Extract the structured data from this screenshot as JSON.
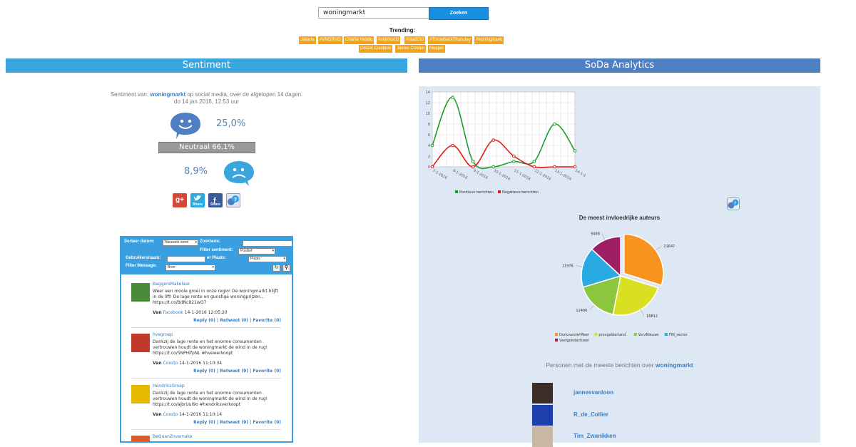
{
  "search": {
    "value": "woningmarkt",
    "button": "Zoeken"
  },
  "trending": {
    "title": "Trending:",
    "tags": [
      "Jakarta",
      "#VNGRNG",
      "Charlie Hebdo",
      "#mijnhoofd",
      "#raad010",
      "#ThrowbackThursday",
      "#woningmarkt",
      "Omzet Coolblue",
      "James Corden",
      "Meppel"
    ]
  },
  "sentiment": {
    "header": "Sentiment",
    "line1_prefix": "Sentiment van:",
    "keyword": "woningmarkt",
    "line1_suffix": "op social media, over de afgelopen 14 dagen.",
    "line2": "do 14 jan 2016, 12:53 uur",
    "positive": "25,0%",
    "neutral": "Neutraal 66,1%",
    "negative": "8,9%",
    "share": {
      "gplus": "g+",
      "twitter": "Share",
      "facebook": "Share"
    }
  },
  "messages": {
    "filters": {
      "sort_label": "Sorteer datum:",
      "sort_value": "Nieuwste eerst",
      "search_label": "Zoekterm:",
      "sentiment_label": "Filter sentiment:",
      "sentiment_value": "Positief",
      "username_label": "Gebruikersnaam:",
      "place_label": "er Plaats:",
      "place_value": "Plaats",
      "message_label": "Filter Message:",
      "source_value": "Bron"
    },
    "items": [
      {
        "user": "BaggersMakelaar",
        "text": "Weer een mooie groei in onze regio! De woningmarkt blijft in de lift! De lage rente en gunstige woningprijzen... https://t.co/BdNc821wO7",
        "van": "Van",
        "source": "Facebook",
        "date": "14-1-2016 12:05:20",
        "actions": "Reply (0) | Retweet (0) | Favorite (0)"
      },
      {
        "user": "hvegroep",
        "text": "Dankzij de lage rente en het enorme consumenten vertrouwen houdt de woningmarkt de wind in de rug! https://t.co/SNPHifpNL #hvewerkoopt",
        "van": "Van",
        "source": "Coosto",
        "date": "14-1-2016 11:10:34",
        "actions": "Reply (0) | Retweet (0) | Favorite (0)"
      },
      {
        "user": "HendriksGroep",
        "text": "Dankzij de lage rente en het enorme consumenten vertrouwen houdt de woningmarkt de wind in de rug! https://t.co/ajbrUuI9o #hendriksverkoopt",
        "van": "Van",
        "source": "Coosto",
        "date": "14-1-2016 11:10:14",
        "actions": "Reply (0) | Retweet (0) | Favorite (0)"
      },
      {
        "user": "BeQuanZnvamake",
        "text": "",
        "van": "",
        "source": "",
        "date": "",
        "actions": ""
      }
    ]
  },
  "analytics": {
    "header": "SoDa Analytics",
    "pie_title": "De meest invloedrijke auteurs",
    "persons_title_prefix": "Personen met de meeste berichten over",
    "persons_keyword": "woningmarkt",
    "persons": [
      "jannesvanloon",
      "R_de_Collier",
      "Tim_Zwanikken"
    ]
  },
  "chart_data": [
    {
      "type": "line",
      "x": [
        "7-1-2016",
        "8-1-2016",
        "9-1-2016",
        "10-1-2016",
        "11-1-2016",
        "12-1-2016",
        "13-1-2016",
        "14-1-2016"
      ],
      "x_values": [
        0,
        1,
        2,
        3,
        4,
        5,
        6,
        7
      ],
      "ylim": [
        0,
        14
      ],
      "yticks": [
        0,
        2,
        4,
        6,
        8,
        10,
        12,
        14
      ],
      "grid": true,
      "legend": "bottom",
      "series": [
        {
          "name": "Positieve berichten",
          "color": "#1a9e2a",
          "points": [
            [
              0,
              4
            ],
            [
              1,
              13
            ],
            [
              2,
              1
            ],
            [
              3,
              0
            ],
            [
              4,
              1
            ],
            [
              5,
              1
            ],
            [
              6,
              8
            ],
            [
              7,
              3
            ]
          ]
        },
        {
          "name": "Negatieve berichten",
          "color": "#e01b1b",
          "points": [
            [
              0,
              0
            ],
            [
              1,
              4
            ],
            [
              2,
              0
            ],
            [
              3,
              5
            ],
            [
              4,
              2
            ],
            [
              5,
              0
            ],
            [
              6,
              0
            ],
            [
              7,
              0
            ]
          ]
        }
      ]
    },
    {
      "type": "pie",
      "title": "De meest invloedrijke auteurs",
      "legend": "bottom",
      "categories": [
        "DurkvanderMeer",
        "provgelderland",
        "VerzNieuws",
        "FIN_sector",
        "Vastgoedactueel"
      ],
      "values": [
        21647,
        16812,
        12496,
        11976,
        9488
      ],
      "colors": [
        "#f7931e",
        "#d9e021",
        "#8cc63f",
        "#29abe2",
        "#9e1f63"
      ]
    }
  ]
}
